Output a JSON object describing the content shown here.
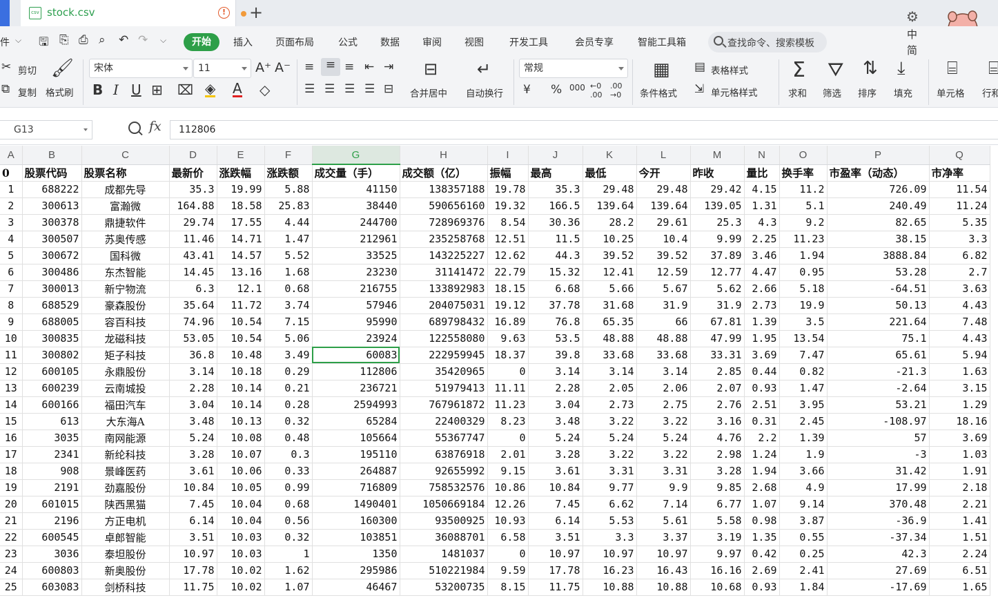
{
  "tab": {
    "title": "stock.csv"
  },
  "menu": {
    "file_partial": "件",
    "start": "开始",
    "items": [
      "插入",
      "页面布局",
      "公式",
      "数据",
      "审阅",
      "视图",
      "开发工具",
      "会员专享",
      "智能工具箱"
    ],
    "search_placeholder": "查找命令、搜索模板"
  },
  "ime": {
    "lang": "中",
    "mode": "简"
  },
  "toolbar": {
    "cut": "剪切",
    "copy": "复制",
    "format_painter": "格式刷",
    "font_name": "宋体",
    "font_size": "11",
    "merge_center": "合并居中",
    "wrap_text": "自动换行",
    "number_format": "常规",
    "conditional_format": "条件格式",
    "table_style": "表格样式",
    "cell_style": "单元格样式",
    "sum": "求和",
    "filter": "筛选",
    "sort": "排序",
    "fill": "填充",
    "cell": "单元格",
    "row_col": "行和"
  },
  "formula": {
    "cell_ref": "G13",
    "value": "112806"
  },
  "grid": {
    "columns": [
      "A",
      "B",
      "C",
      "D",
      "E",
      "F",
      "G",
      "H",
      "I",
      "J",
      "K",
      "L",
      "M",
      "N",
      "O",
      "P",
      "Q"
    ],
    "selected_column": "G",
    "selected_cell": "G13",
    "header_row": [
      "0",
      "股票代码",
      "股票名称",
      "最新价",
      "涨跌幅",
      "涨跌额",
      "成交量（手）",
      "成交额（亿）",
      "振幅",
      "最高",
      "最低",
      "今开",
      "昨收",
      "量比",
      "换手率",
      "市盈率（动态）",
      "市净率"
    ],
    "rows": [
      [
        "1",
        "688222",
        "成都先导",
        "35.3",
        "19.99",
        "5.88",
        "41150",
        "138357188",
        "19.78",
        "35.3",
        "29.48",
        "29.48",
        "29.42",
        "4.15",
        "11.2",
        "726.09",
        "11.54"
      ],
      [
        "2",
        "300613",
        "富瀚微",
        "164.88",
        "18.58",
        "25.83",
        "38440",
        "590656160",
        "19.32",
        "166.5",
        "139.64",
        "139.64",
        "139.05",
        "1.31",
        "5.1",
        "240.49",
        "11.24"
      ],
      [
        "3",
        "300378",
        "鼎捷软件",
        "29.74",
        "17.55",
        "4.44",
        "244700",
        "728969376",
        "8.54",
        "30.36",
        "28.2",
        "29.61",
        "25.3",
        "4.3",
        "9.2",
        "82.65",
        "5.35"
      ],
      [
        "4",
        "300507",
        "苏奥传感",
        "11.46",
        "14.71",
        "1.47",
        "212961",
        "235258768",
        "12.51",
        "11.5",
        "10.25",
        "10.4",
        "9.99",
        "2.25",
        "11.23",
        "38.15",
        "3.3"
      ],
      [
        "5",
        "300672",
        "国科微",
        "43.41",
        "14.57",
        "5.52",
        "33525",
        "143225227",
        "12.62",
        "44.3",
        "39.52",
        "39.52",
        "37.89",
        "3.46",
        "1.94",
        "3888.84",
        "6.82"
      ],
      [
        "6",
        "300486",
        "东杰智能",
        "14.45",
        "13.16",
        "1.68",
        "23230",
        "31141472",
        "22.79",
        "15.32",
        "12.41",
        "12.59",
        "12.77",
        "4.47",
        "0.95",
        "53.28",
        "2.7"
      ],
      [
        "7",
        "300013",
        "新宁物流",
        "6.3",
        "12.1",
        "0.68",
        "216755",
        "133892983",
        "18.15",
        "6.68",
        "5.66",
        "5.67",
        "5.62",
        "2.66",
        "5.18",
        "-64.51",
        "3.63"
      ],
      [
        "8",
        "688529",
        "豪森股份",
        "35.64",
        "11.72",
        "3.74",
        "57946",
        "204075031",
        "19.12",
        "37.78",
        "31.68",
        "31.9",
        "31.9",
        "2.73",
        "19.9",
        "50.13",
        "4.43"
      ],
      [
        "9",
        "688005",
        "容百科技",
        "74.96",
        "10.54",
        "7.15",
        "95990",
        "689798432",
        "16.89",
        "76.8",
        "65.35",
        "66",
        "67.81",
        "1.39",
        "3.5",
        "221.64",
        "7.48"
      ],
      [
        "10",
        "300835",
        "龙磁科技",
        "53.05",
        "10.54",
        "5.06",
        "23924",
        "122558080",
        "9.63",
        "53.5",
        "48.88",
        "48.88",
        "47.99",
        "1.95",
        "13.54",
        "75.1",
        "4.43"
      ],
      [
        "11",
        "300802",
        "矩子科技",
        "36.8",
        "10.48",
        "3.49",
        "60083",
        "222959945",
        "18.37",
        "39.8",
        "33.68",
        "33.68",
        "33.31",
        "3.69",
        "7.47",
        "65.61",
        "5.94"
      ],
      [
        "12",
        "600105",
        "永鼎股份",
        "3.14",
        "10.18",
        "0.29",
        "112806",
        "35420965",
        "0",
        "3.14",
        "3.14",
        "3.14",
        "2.85",
        "0.44",
        "0.82",
        "-21.3",
        "1.63"
      ],
      [
        "13",
        "600239",
        "云南城投",
        "2.28",
        "10.14",
        "0.21",
        "236721",
        "51979413",
        "11.11",
        "2.28",
        "2.05",
        "2.06",
        "2.07",
        "0.93",
        "1.47",
        "-2.64",
        "3.15"
      ],
      [
        "14",
        "600166",
        "福田汽车",
        "3.04",
        "10.14",
        "0.28",
        "2594993",
        "767961872",
        "11.23",
        "3.04",
        "2.73",
        "2.75",
        "2.76",
        "2.51",
        "3.95",
        "53.21",
        "1.29"
      ],
      [
        "15",
        "613",
        "大东海A",
        "3.48",
        "10.13",
        "0.32",
        "65284",
        "22400329",
        "8.23",
        "3.48",
        "3.22",
        "3.22",
        "3.16",
        "0.31",
        "2.45",
        "-108.97",
        "18.16"
      ],
      [
        "16",
        "3035",
        "南网能源",
        "5.24",
        "10.08",
        "0.48",
        "105664",
        "55367747",
        "0",
        "5.24",
        "5.24",
        "5.24",
        "4.76",
        "2.2",
        "1.39",
        "57",
        "3.69"
      ],
      [
        "17",
        "2341",
        "新纶科技",
        "3.28",
        "10.07",
        "0.3",
        "195110",
        "63876918",
        "2.01",
        "3.28",
        "3.22",
        "3.22",
        "2.98",
        "1.24",
        "1.9",
        "-3",
        "1.03"
      ],
      [
        "18",
        "908",
        "景峰医药",
        "3.61",
        "10.06",
        "0.33",
        "264887",
        "92655992",
        "9.15",
        "3.61",
        "3.31",
        "3.31",
        "3.28",
        "1.94",
        "3.66",
        "31.42",
        "1.91"
      ],
      [
        "19",
        "2191",
        "劲嘉股份",
        "10.84",
        "10.05",
        "0.99",
        "716809",
        "758532576",
        "10.86",
        "10.84",
        "9.77",
        "9.9",
        "9.85",
        "2.68",
        "4.9",
        "17.99",
        "2.18"
      ],
      [
        "20",
        "601015",
        "陕西黑猫",
        "7.45",
        "10.04",
        "0.68",
        "1490401",
        "1050669184",
        "12.26",
        "7.45",
        "6.62",
        "7.14",
        "6.77",
        "1.07",
        "9.14",
        "370.48",
        "2.21"
      ],
      [
        "21",
        "2196",
        "方正电机",
        "6.14",
        "10.04",
        "0.56",
        "160300",
        "93500925",
        "10.93",
        "6.14",
        "5.53",
        "5.61",
        "5.58",
        "0.98",
        "3.87",
        "-36.9",
        "1.41"
      ],
      [
        "22",
        "600545",
        "卓郎智能",
        "3.51",
        "10.03",
        "0.32",
        "103851",
        "36088701",
        "6.58",
        "3.51",
        "3.3",
        "3.37",
        "3.19",
        "1.35",
        "0.55",
        "-37.34",
        "1.51"
      ],
      [
        "23",
        "3036",
        "泰坦股份",
        "10.97",
        "10.03",
        "1",
        "1350",
        "1481037",
        "0",
        "10.97",
        "10.97",
        "10.97",
        "9.97",
        "0.42",
        "0.25",
        "42.3",
        "2.24"
      ],
      [
        "24",
        "600803",
        "新奥股份",
        "17.78",
        "10.02",
        "1.62",
        "295986",
        "510221984",
        "9.59",
        "17.78",
        "16.23",
        "16.43",
        "16.16",
        "2.69",
        "2.41",
        "27.69",
        "6.51"
      ],
      [
        "25",
        "603083",
        "剑桥科技",
        "11.75",
        "10.02",
        "1.07",
        "46467",
        "53200735",
        "8.15",
        "11.75",
        "10.88",
        "10.88",
        "10.68",
        "0.93",
        "1.84",
        "-17.69",
        "1.65"
      ]
    ]
  }
}
